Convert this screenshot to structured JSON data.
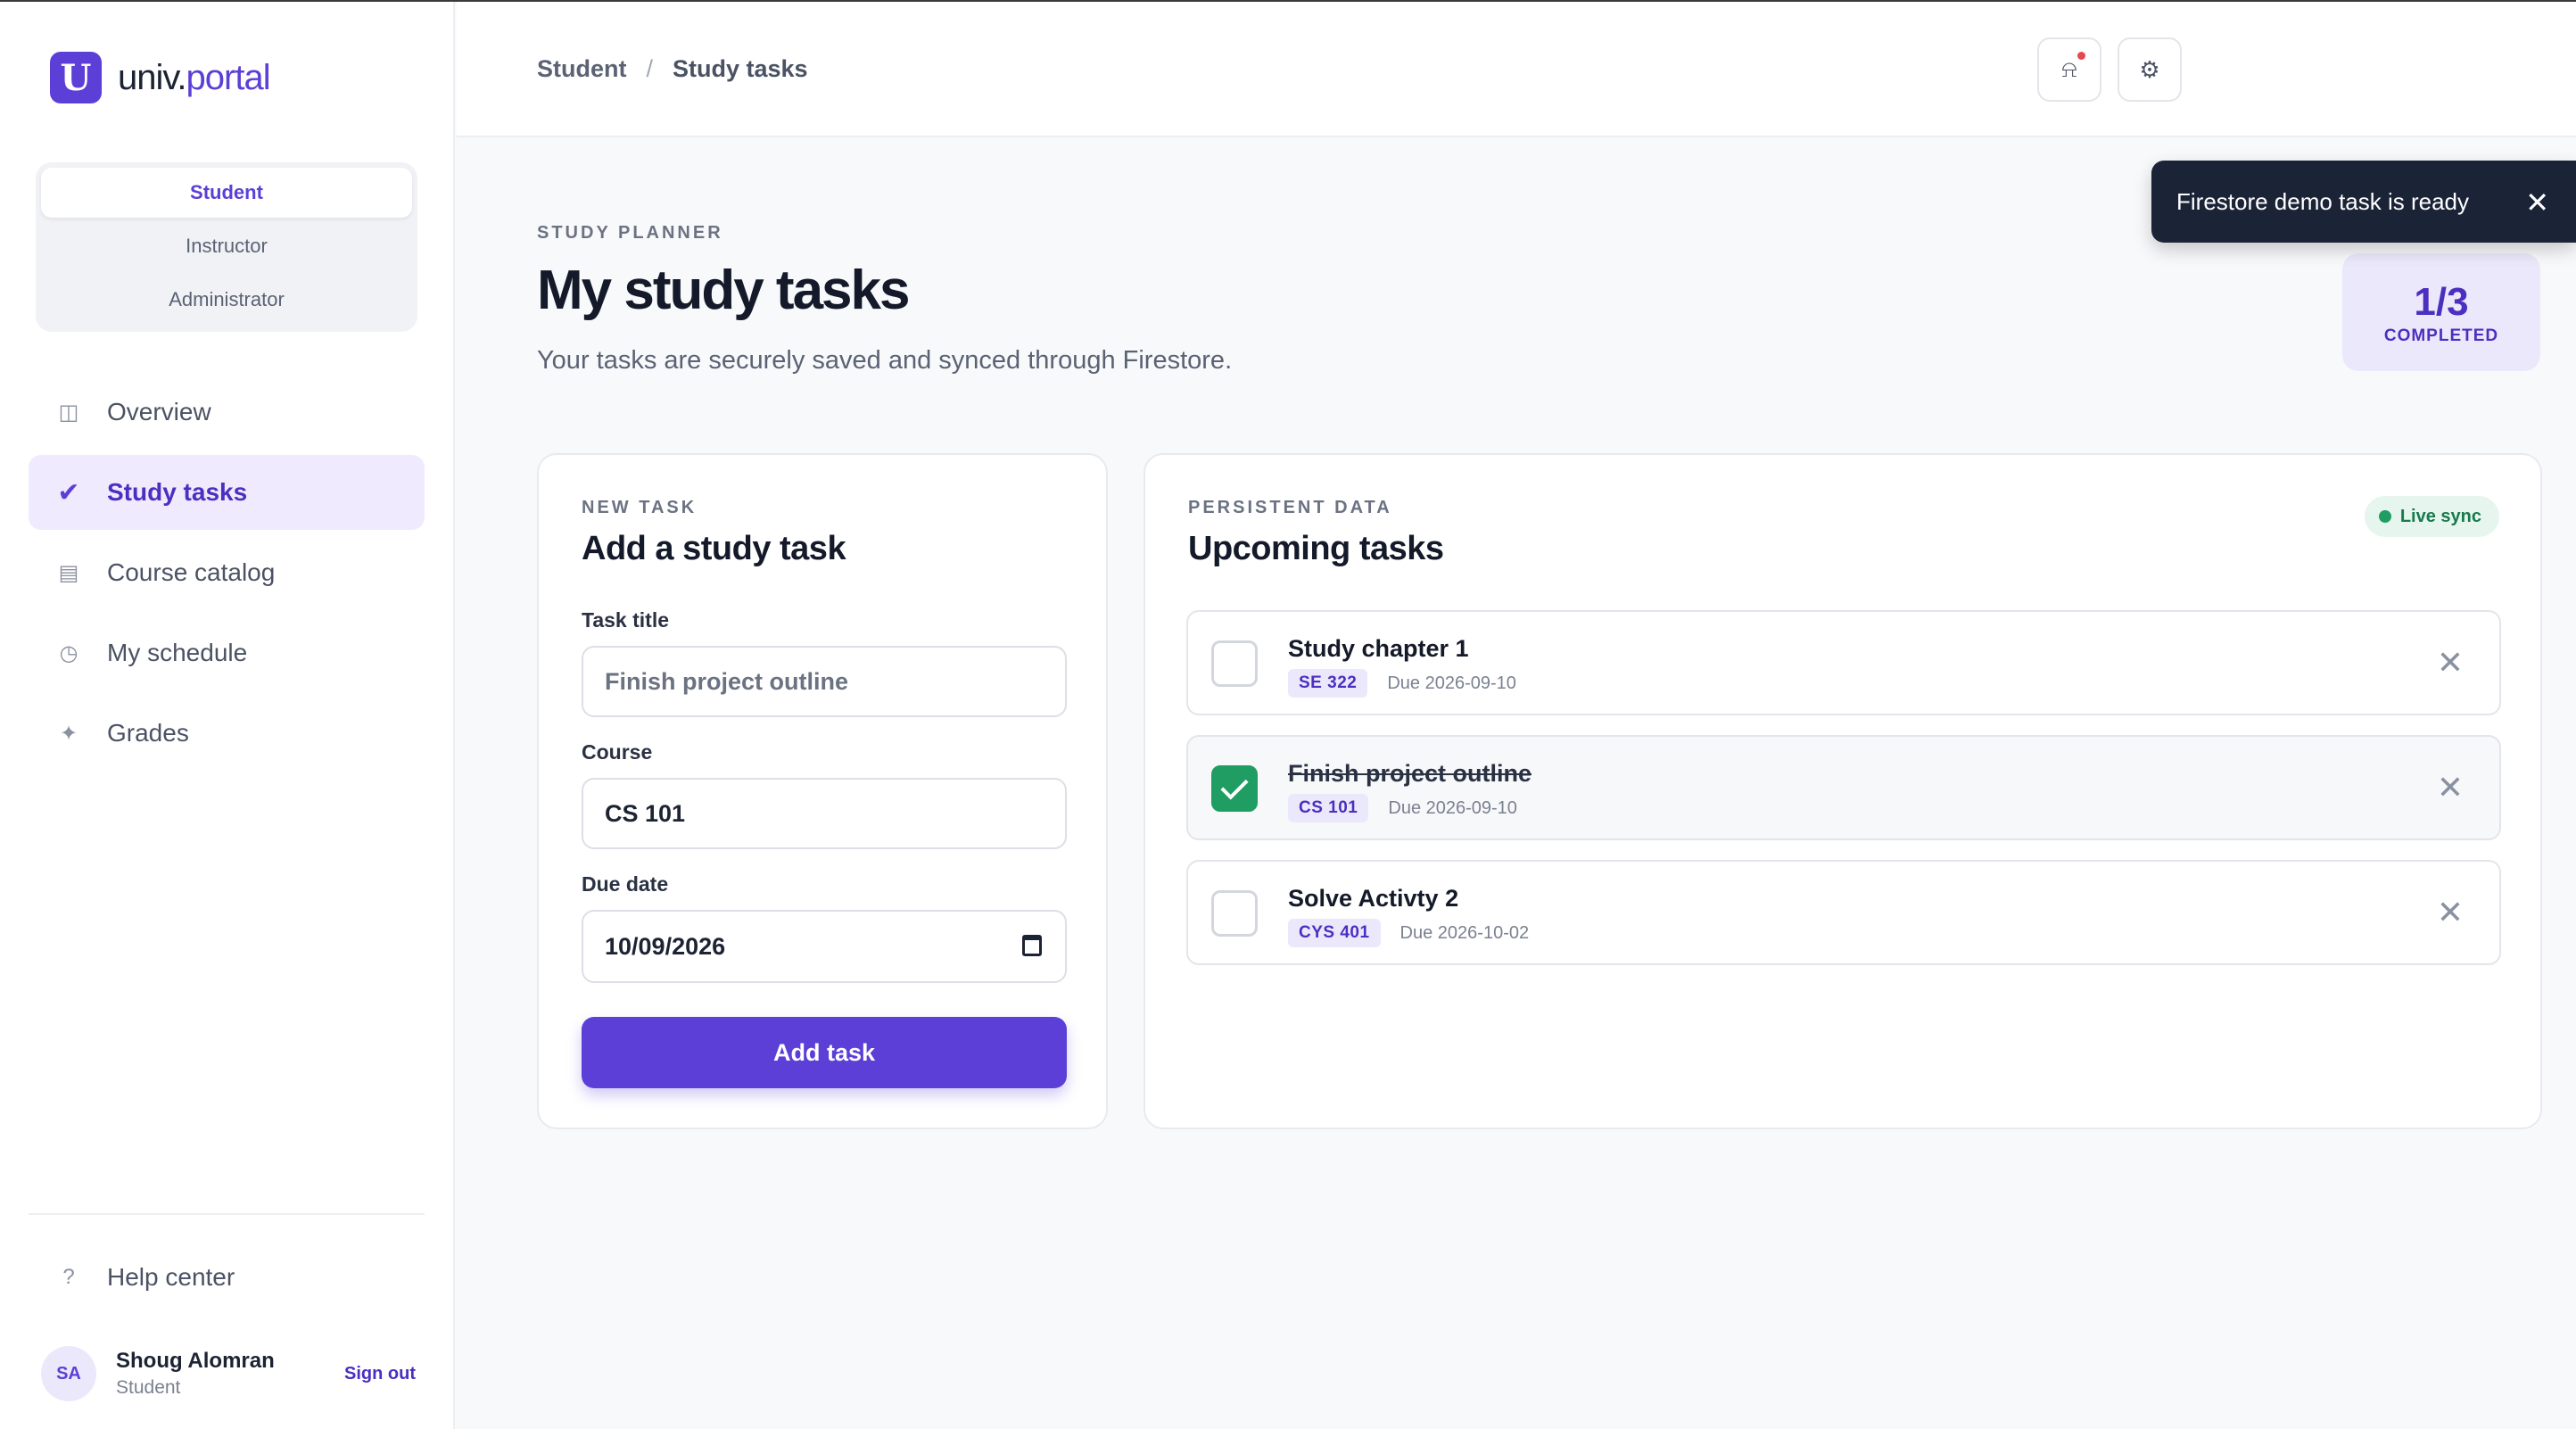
{
  "app": {
    "logo_letter": "U",
    "logo_name_a": "univ.",
    "logo_name_b": "portal"
  },
  "roles": [
    {
      "label": "Student",
      "active": true
    },
    {
      "label": "Instructor",
      "active": false
    },
    {
      "label": "Administrator",
      "active": false
    }
  ],
  "nav": [
    {
      "label": "Overview",
      "icon": "layout-icon",
      "glyph": "◫",
      "active": false
    },
    {
      "label": "Study tasks",
      "icon": "check-icon",
      "glyph": "✔",
      "active": true
    },
    {
      "label": "Course catalog",
      "icon": "catalog-icon",
      "glyph": "▤",
      "active": false
    },
    {
      "label": "My schedule",
      "icon": "clock-icon",
      "glyph": "◷",
      "active": false
    },
    {
      "label": "Grades",
      "icon": "sparkle-icon",
      "glyph": "✦",
      "active": false
    }
  ],
  "help": {
    "label": "Help center",
    "glyph": "?"
  },
  "user": {
    "initials": "SA",
    "name": "Shoug Alomran",
    "role": "Student",
    "signout": "Sign out"
  },
  "breadcrumb": {
    "first": "Student",
    "sep": "/",
    "current": "Study tasks"
  },
  "topbar": {
    "notifications_glyph": "⍾",
    "settings_glyph": "⚙"
  },
  "toast": {
    "message": "Firestore demo task is ready",
    "close": "✕"
  },
  "header": {
    "eyebrow": "STUDY PLANNER",
    "title": "My study tasks",
    "subtitle": "Your tasks are securely saved and synced through Firestore."
  },
  "progress": {
    "value": "1/3",
    "label": "COMPLETED",
    "done": 1,
    "total": 3
  },
  "form": {
    "eyebrow": "NEW TASK",
    "title": "Add a study task",
    "task_title_label": "Task title",
    "task_title_placeholder": "Finish project outline",
    "course_label": "Course",
    "course_value": "CS 101",
    "due_label": "Due date",
    "due_value": "10/09/2026",
    "submit": "Add task"
  },
  "list": {
    "eyebrow": "PERSISTENT DATA",
    "title": "Upcoming tasks",
    "badge": "Live sync",
    "delete_glyph": "✕",
    "tasks": [
      {
        "title": "Study chapter 1",
        "course": "SE 322",
        "due": "Due 2026-09-10",
        "done": false
      },
      {
        "title": "Finish project outline",
        "course": "CS 101",
        "due": "Due 2026-09-10",
        "done": true
      },
      {
        "title": "Solve Activty 2",
        "course": "CYS 401",
        "due": "Due 2026-10-02",
        "done": false
      }
    ]
  },
  "colors": {
    "accent": "#5b3fd6",
    "accent_soft": "#ece8fb",
    "success": "#1f9d62",
    "toast_bg": "#1b2337"
  }
}
